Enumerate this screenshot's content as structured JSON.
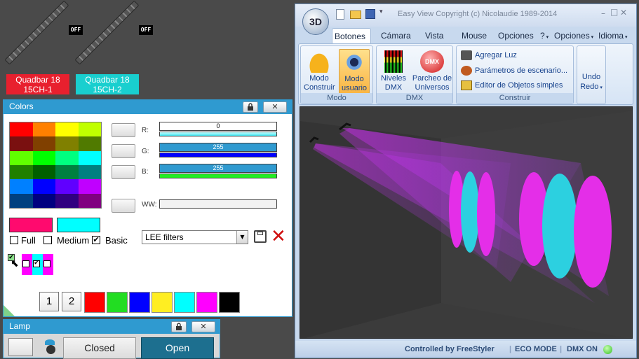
{
  "fixtures": [
    {
      "off": "OFF",
      "line1": "Quadbar 18",
      "line2": "15CH-1",
      "color": "#e8202e"
    },
    {
      "off": "OFF",
      "line1": "Quadbar 18",
      "line2": "15CH-2",
      "color": "#19cfcf"
    }
  ],
  "colors": {
    "title": "Colors",
    "palette": [
      "#ff0000",
      "#ff8000",
      "#ffff00",
      "#c0ff00",
      "#7a1010",
      "#804000",
      "#808000",
      "#507a00",
      "#60ff00",
      "#00ff00",
      "#00ff80",
      "#00ffff",
      "#208000",
      "#006000",
      "#008040",
      "#008080",
      "#0080ff",
      "#0000ff",
      "#6000ff",
      "#c000ff",
      "#004080",
      "#000080",
      "#300080",
      "#800080",
      "#ff8080",
      "#ff0080",
      "#800040",
      "#ffffff"
    ],
    "r_label": "R:",
    "g_label": "G:",
    "b_label": "B:",
    "ww_label": "WW:",
    "r_value": "0",
    "g_value": "255",
    "b_value": "255",
    "current_color_a": "#ff0a6e",
    "current_color_b": "#00ffff",
    "full_label": "Full",
    "medium_label": "Medium",
    "basic_label": "Basic",
    "basic_checked": "✔",
    "filter_select": "LEE filters",
    "btn1": "1",
    "btn2": "2",
    "quick_colors": [
      "#ff0000",
      "#22dd22",
      "#0000ff",
      "#ffee22",
      "#00ffff",
      "#ff00ff",
      "#000000"
    ]
  },
  "lamp": {
    "title": "Lamp",
    "closed": "Closed",
    "open": "Open"
  },
  "easyview": {
    "title": "Easy View   Copyright (c) Nicolaudie 1989-2014",
    "logo": "3D",
    "tabs": [
      "Botones e",
      "Cámara",
      "Vista",
      "Mouse",
      "Opciones",
      "?",
      "Opciones",
      "Idioma"
    ],
    "groups": {
      "modo": {
        "label": "Modo",
        "construir": "Modo Construir",
        "usuario": "Modo usuario"
      },
      "dmx": {
        "label": "DMX",
        "niveles": "Niveles DMX",
        "parcheo": "Parcheo de Universos"
      },
      "construir": {
        "label": "Construir",
        "agregar": "Agregar Luz",
        "parametros": "Parámetros de escenario...",
        "editor": "Editor de Objetos simples"
      },
      "undo": {
        "undo": "Undo",
        "redo": "Redo"
      }
    },
    "status": {
      "controlled": "Controlled by FreeStyler",
      "eco": "ECO MODE",
      "dmx": "DMX ON"
    }
  }
}
